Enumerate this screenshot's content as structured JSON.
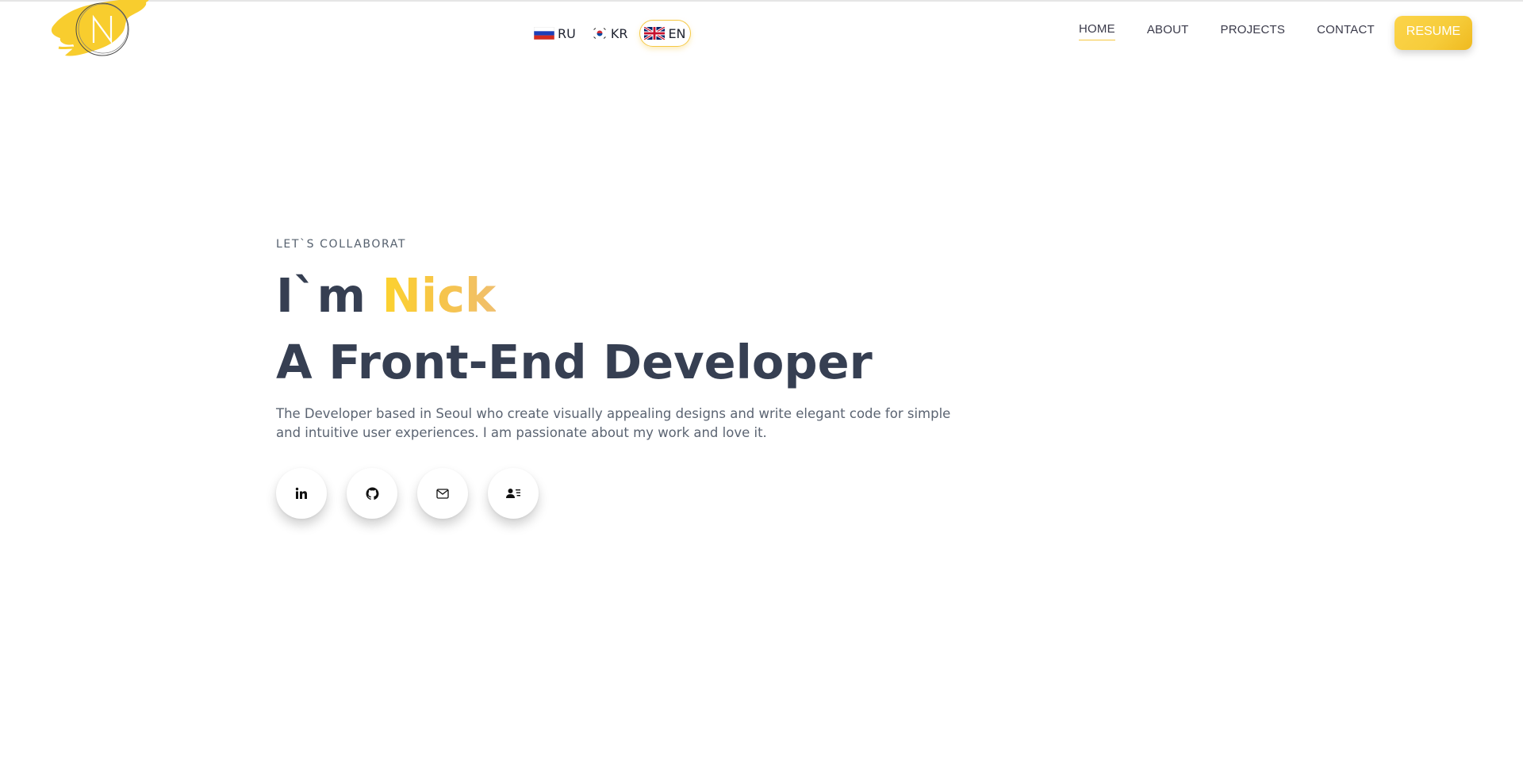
{
  "header": {
    "languages": [
      {
        "code": "RU",
        "active": false
      },
      {
        "code": "KR",
        "active": false
      },
      {
        "code": "EN",
        "active": true
      }
    ],
    "nav": [
      {
        "label": "HOME",
        "active": true
      },
      {
        "label": "ABOUT",
        "active": false
      },
      {
        "label": "PROJECTS",
        "active": false
      },
      {
        "label": "CONTACT",
        "active": false
      }
    ],
    "resume_label": "RESUME"
  },
  "hero": {
    "eyebrow": "LET`S COLLABORAT",
    "greeting_prefix": "I`m ",
    "greeting_name": "Nick",
    "role": "A Front-End Developer",
    "description": "The Developer based in Seoul who create visually appealing designs and write elegant code for simple and intuitive user experiences. I am passionate about my work and love it."
  },
  "socials": [
    {
      "icon": "linkedin-icon"
    },
    {
      "icon": "github-icon"
    },
    {
      "icon": "mail-icon"
    },
    {
      "icon": "contact-card-icon"
    }
  ],
  "colors": {
    "accent": "#f5c842",
    "heading": "#363f52",
    "body_text": "#5b6472"
  }
}
